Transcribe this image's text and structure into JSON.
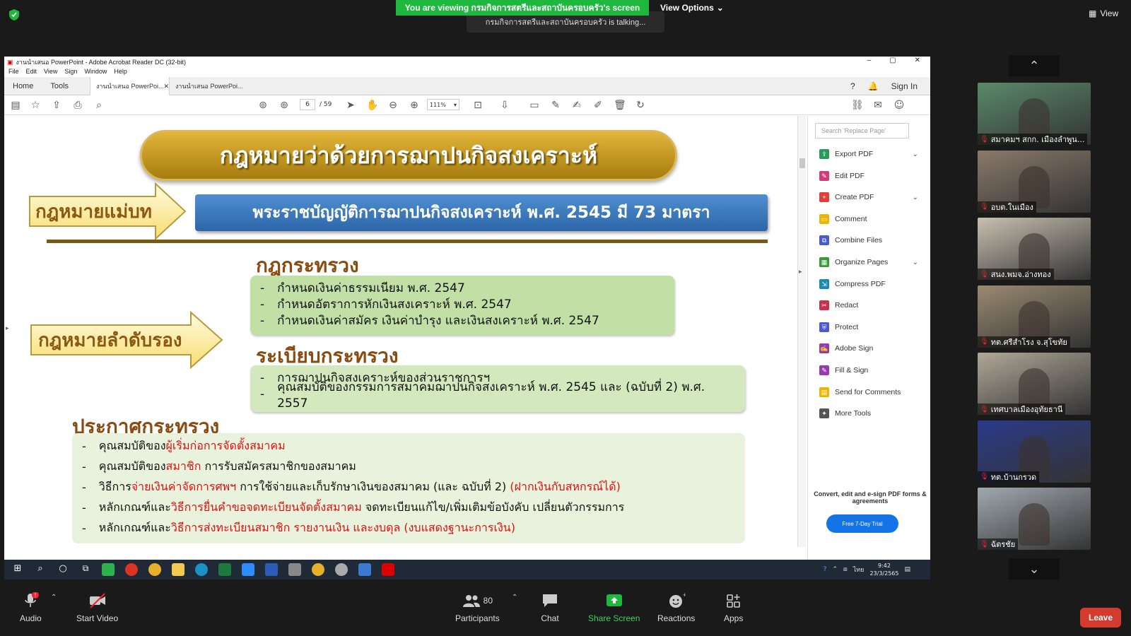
{
  "zoom": {
    "banner": "You are viewing กรมกิจการสตรีและสถาบันครอบครัว's screen",
    "view_options": "View Options",
    "talking": "กรมกิจการสตรีและสถาบันครอบครัว is talking...",
    "gallery_view": "View",
    "participants_count": "80",
    "bottom": {
      "audio": "Audio",
      "start_video": "Start Video",
      "participants": "Participants",
      "chat": "Chat",
      "share_screen": "Share Screen",
      "reactions": "Reactions",
      "apps": "Apps",
      "leave": "Leave"
    },
    "accent": "#1fb83f",
    "leave_color": "#d33b2f"
  },
  "acrobat": {
    "title": "งานนำเสนอ PowerPoint - Adobe Acrobat Reader DC (32-bit)",
    "menu": [
      "File",
      "Edit",
      "View",
      "Sign",
      "Window",
      "Help"
    ],
    "tabs": {
      "home": "Home",
      "tools": "Tools",
      "doc1": "งานนำเสนอ PowerPoi...",
      "doc2": "งานนำเสนอ PowerPoi...",
      "sign_in": "Sign In"
    },
    "page_current": "6",
    "page_total": "/ 59",
    "zoom_level": "111%",
    "tools_pane": {
      "search_placeholder": "Search 'Replace Page'",
      "items": [
        {
          "label": "Export PDF",
          "color": "#2c9a5a",
          "chev": "⌄"
        },
        {
          "label": "Edit PDF",
          "color": "#d23b7a",
          "chev": ""
        },
        {
          "label": "Create PDF",
          "color": "#e0413a",
          "chev": "⌄"
        },
        {
          "label": "Comment",
          "color": "#f0b400",
          "chev": ""
        },
        {
          "label": "Combine Files",
          "color": "#4a5ad0",
          "chev": ""
        },
        {
          "label": "Organize Pages",
          "color": "#3a9a3a",
          "chev": "⌄"
        },
        {
          "label": "Compress PDF",
          "color": "#1a8ab0",
          "chev": ""
        },
        {
          "label": "Redact",
          "color": "#c8334a",
          "chev": ""
        },
        {
          "label": "Protect",
          "color": "#4a5ad0",
          "chev": ""
        },
        {
          "label": "Adobe Sign",
          "color": "#9a3ab0",
          "chev": ""
        },
        {
          "label": "Fill & Sign",
          "color": "#9a3ab0",
          "chev": ""
        },
        {
          "label": "Send for Comments",
          "color": "#f0b400",
          "chev": ""
        },
        {
          "label": "More Tools",
          "color": "#555555",
          "chev": ""
        }
      ],
      "promo": "Convert, edit and e-sign PDF forms & agreements",
      "trial": "Free 7-Day Trial"
    }
  },
  "slide": {
    "title": "กฎหมายว่าด้วยการฌาปนกิจสงเคราะห์",
    "parent_law_label": "กฎหมายแม่บท",
    "act": "พระราชบัญญัติการฌาปนกิจสงเคราะห์ พ.ศ. 2545 มี 73 มาตรา",
    "secondary_law_label": "กฎหมายลำดับรอง",
    "ministerial_rules_heading": "กฎกระทรวง",
    "ministerial_rules": [
      "กำหนดเงินค่าธรรมเนียม พ.ศ. 2547",
      "กำหนดอัตราการหักเงินสงเคราะห์ พ.ศ. 2547",
      "กำหนดเงินค่าสมัคร เงินค่าบำรุง และเงินสงเคราะห์ พ.ศ. 2547"
    ],
    "regulations_heading": "ระเบียบกระทรวง",
    "regulations": [
      "การฌาปนกิจสงเคราะห์ของส่วนราชการฯ",
      "คุณสมบัติของกรรมการสมาคมฌาปนกิจสงเคราะห์ พ.ศ. 2545 และ (ฉบับที่ 2) พ.ศ. 2557"
    ],
    "announcements_heading": "ประกาศกระทรวง",
    "announcements": [
      {
        "a": "คุณสมบัติของ",
        "b": "ผู้เริ่มก่อการจัดตั้งสมาคม",
        "c": ""
      },
      {
        "a": "คุณสมบัติของ",
        "b": "สมาชิก",
        "c": " การรับสมัครสมาชิกของสมาคม"
      },
      {
        "a": "วิธีการ",
        "b": "จ่ายเงินค่าจัดการศพฯ",
        "c": " การใช้จ่ายและเก็บรักษาเงินของสมาคม (และ ฉบับที่ 2) ",
        "d": "(ฝากเงินกับสหกรณ์ได้)"
      },
      {
        "a": "หลักเกณฑ์และ",
        "b": "วิธีการยื่นคำขอจดทะเบียนจัดตั้งสมาคม",
        "c": " จดทะเบียนแก้ไข/เพิ่มเติมข้อบังคับ เปลี่ยนตัวกรรมการ"
      },
      {
        "a": "หลักเกณฑ์และ",
        "b": "วิธีการส่งทะเบียนสมาชิก รายงานเงิน และงบดุล (งบแสดงฐานะการเงิน)",
        "c": ""
      }
    ],
    "bullet": "-"
  },
  "taskbar": {
    "clock_time": "9:42",
    "clock_date": "23/3/2565",
    "lang": "ไทย"
  },
  "participants": [
    {
      "name": "สมาคมฯ สกก. เมืองลำพูน...",
      "bg": "#5a8a6a"
    },
    {
      "name": "อบต.ในเมือง",
      "bg": "#8a7a6a"
    },
    {
      "name": "สนง.พมจ.อ่างทอง",
      "bg": "#c8c0b0"
    },
    {
      "name": "ทต.ศรีสำโรง จ.สุโขทัย",
      "bg": "#9a8a70"
    },
    {
      "name": "เทศบาลเมืองอุทัยธานี",
      "bg": "#b0a898"
    },
    {
      "name": "ทต.บ้านกรวด",
      "bg": "#2a3a8a"
    },
    {
      "name": "ฉัตรชัย",
      "bg": "#a0a8b0"
    }
  ]
}
